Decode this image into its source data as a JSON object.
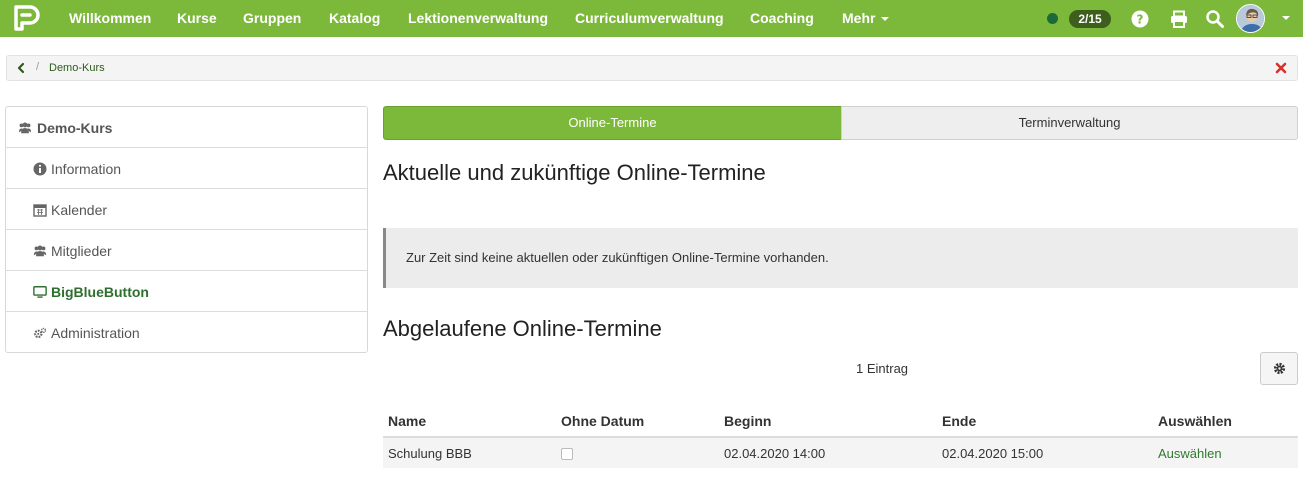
{
  "nav": {
    "items": [
      {
        "label": "Willkommen"
      },
      {
        "label": "Kurse"
      },
      {
        "label": "Gruppen"
      },
      {
        "label": "Katalog"
      },
      {
        "label": "Lektionenverwaltung"
      },
      {
        "label": "Curriculumverwaltung"
      },
      {
        "label": "Coaching"
      },
      {
        "label": "Mehr"
      }
    ],
    "counter": "2/15",
    "status_color": "#1b6b3a",
    "icons": [
      "help-icon",
      "print-icon",
      "search-icon",
      "avatar",
      "chevron-down-icon"
    ]
  },
  "breadcrumb": {
    "item": "Demo-Kurs"
  },
  "sidemenu": {
    "header": "Demo-Kurs",
    "items": [
      {
        "label": "Information",
        "icon": "info-icon"
      },
      {
        "label": "Kalender",
        "icon": "calendar-icon"
      },
      {
        "label": "Mitglieder",
        "icon": "users-icon"
      },
      {
        "label": "BigBlueButton",
        "icon": "monitor-icon",
        "active": true
      },
      {
        "label": "Administration",
        "icon": "gears-icon"
      }
    ]
  },
  "tabs": {
    "active": "Online-Termine",
    "inactive": "Terminverwaltung"
  },
  "main": {
    "current_heading": "Aktuelle und zukünftige Online-Termine",
    "notice": "Zur Zeit sind keine aktuellen oder zukünftigen Online-Termine vorhanden.",
    "past_heading": "Abgelaufene Online-Termine",
    "count": "1 Eintrag"
  },
  "table": {
    "headers": [
      "Name",
      "Ohne Datum",
      "Beginn",
      "Ende",
      "Auswählen"
    ],
    "rows": [
      {
        "name": "Schulung BBB",
        "ohne_datum": false,
        "beginn": "02.04.2020 14:00",
        "ende": "02.04.2020 15:00",
        "action": "Auswählen"
      }
    ]
  },
  "colors": {
    "brand": "#7cb83a",
    "link": "#2f7a2f",
    "close": "#d9302c"
  }
}
